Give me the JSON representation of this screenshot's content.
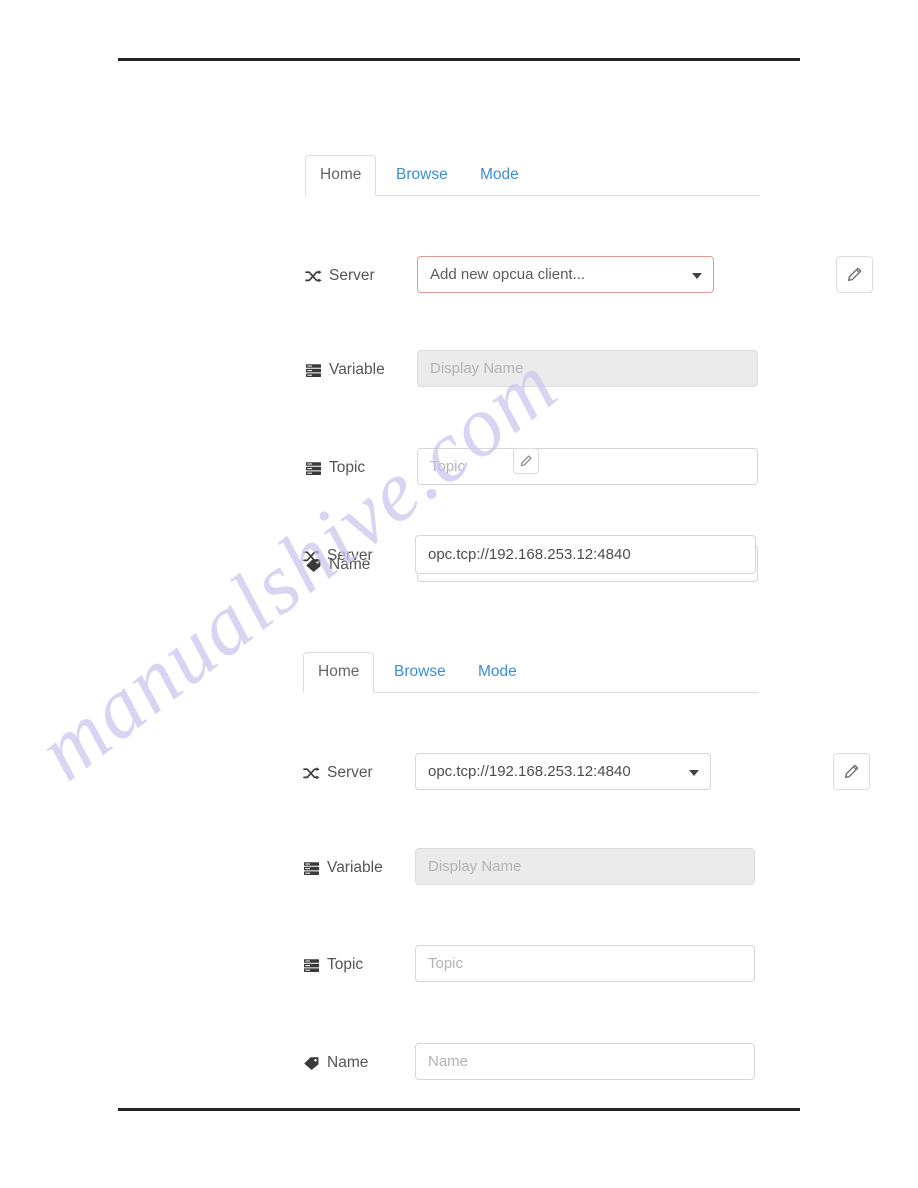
{
  "page": {
    "rules": {
      "top_label": "header-rule",
      "bottom_label": "footer-rule"
    },
    "watermark": "manualshive.com"
  },
  "panel_one": {
    "tabs": [
      {
        "label": "Home",
        "active": true
      },
      {
        "label": "Browse",
        "active": false
      },
      {
        "label": "Mode",
        "active": false
      }
    ],
    "fields": {
      "server": {
        "label": "Server",
        "icon": "shuffle-icon",
        "value": "Add new opcua client...",
        "invalid": true,
        "edit_button_icon": "pencil-icon"
      },
      "variable": {
        "label": "Variable",
        "icon": "server-icon",
        "value": "",
        "placeholder": "Display Name",
        "disabled": true
      },
      "topic": {
        "label": "Topic",
        "icon": "server-icon",
        "value": "",
        "placeholder": "Topic",
        "disabled": false
      },
      "name": {
        "label": "Name",
        "icon": "tag-icon",
        "value": "",
        "placeholder": "Name",
        "disabled": false
      }
    }
  },
  "float_edit_button": {
    "icon": "pencil-icon"
  },
  "float_server": {
    "label": "Server",
    "icon": "shuffle-icon",
    "value": "opc.tcp://192.168.253.12:4840"
  },
  "panel_two": {
    "tabs": [
      {
        "label": "Home",
        "active": true
      },
      {
        "label": "Browse",
        "active": false
      },
      {
        "label": "Mode",
        "active": false
      }
    ],
    "fields": {
      "server": {
        "label": "Server",
        "icon": "shuffle-icon",
        "value": "opc.tcp://192.168.253.12:4840",
        "invalid": false,
        "edit_button_icon": "pencil-icon"
      },
      "variable": {
        "label": "Variable",
        "icon": "server-icon",
        "value": "",
        "placeholder": "Display Name",
        "disabled": true
      },
      "topic": {
        "label": "Topic",
        "icon": "server-icon",
        "value": "",
        "placeholder": "Topic",
        "disabled": false
      },
      "name": {
        "label": "Name",
        "icon": "tag-icon",
        "value": "",
        "placeholder": "Name",
        "disabled": false
      }
    }
  },
  "colors": {
    "link": "#3b8fd4",
    "invalid_border": "#e09a94",
    "rule": "#232323",
    "watermark": "#c9c6ee",
    "field_border": "#d6d6d6",
    "disabled_bg": "#ebebeb"
  }
}
